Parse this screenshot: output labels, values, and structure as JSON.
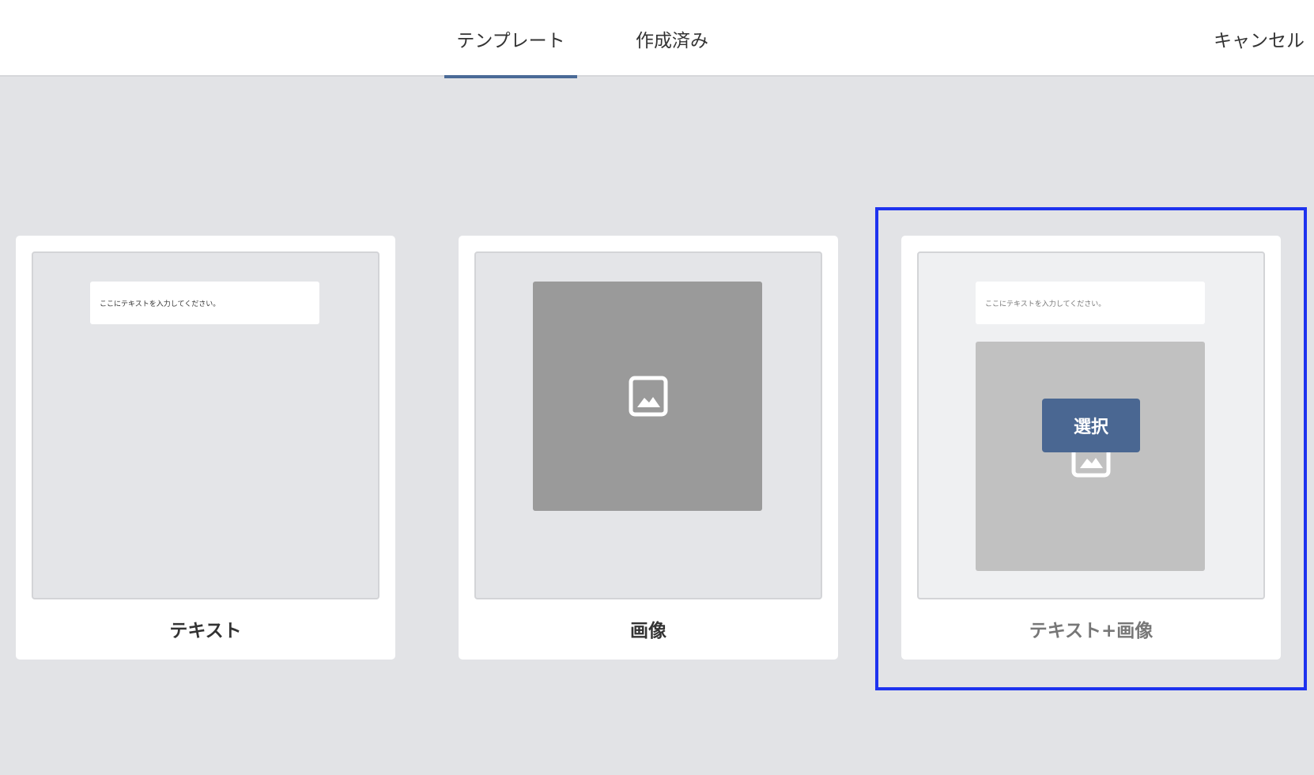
{
  "header": {
    "tabs": [
      {
        "label": "テンプレート",
        "active": true
      },
      {
        "label": "作成済み",
        "active": false
      }
    ],
    "cancel_label": "キャンセル",
    "accent_color": "#4a6a97"
  },
  "cards": [
    {
      "label": "テキスト",
      "text_placeholder": "ここにテキストを入力してください。"
    },
    {
      "label": "画像",
      "icon": "image-icon"
    },
    {
      "label": "テキスト+画像",
      "text_placeholder": "ここにテキストを入力してください。",
      "icon": "image-icon",
      "select_label": "選択",
      "highlighted": true
    }
  ],
  "colors": {
    "background": "#e2e3e6",
    "select_button": "#4a6792",
    "highlight_border": "#1e33ef"
  }
}
